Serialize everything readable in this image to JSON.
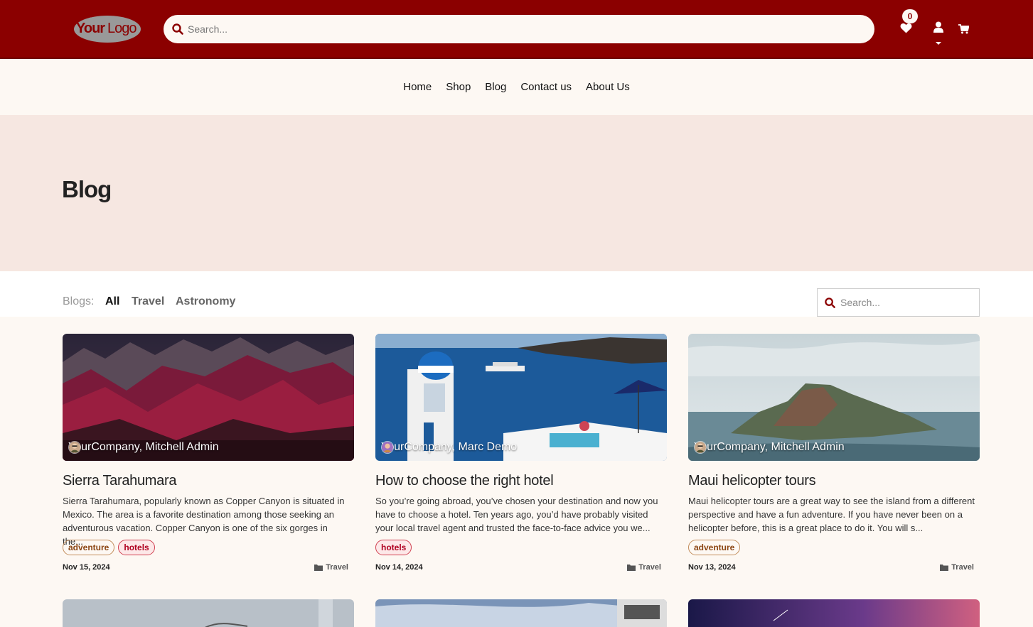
{
  "header": {
    "logo_text": "YourLogo",
    "search_placeholder": "Search...",
    "wishlist_count": "0",
    "brand_color": "#8b0000"
  },
  "nav": {
    "items": [
      {
        "label": "Home"
      },
      {
        "label": "Shop"
      },
      {
        "label": "Blog"
      },
      {
        "label": "Contact us"
      },
      {
        "label": "About Us"
      }
    ]
  },
  "hero": {
    "title": "Blog"
  },
  "filters": {
    "label": "Blogs:",
    "items": [
      {
        "label": "All",
        "active": true
      },
      {
        "label": "Travel",
        "active": false
      },
      {
        "label": "Astronomy",
        "active": false
      }
    ],
    "search_placeholder": "Search..."
  },
  "posts": [
    {
      "author": "YourCompany, Mitchell Admin",
      "title": "Sierra Tarahumara",
      "excerpt": "Sierra Tarahumara, popularly known as Copper Canyon is situated in Mexico. The area is a favorite destination among those seeking an adventurous vacation. Copper Canyon is one of the six gorges in the...",
      "tags": [
        "adventure",
        "hotels"
      ],
      "date": "Nov 15, 2024",
      "category": "Travel"
    },
    {
      "author": "YourCompany, Marc Demo",
      "title": "How to choose the right hotel",
      "excerpt": "So you’re going abroad, you’ve chosen your destination and now you have to choose a hotel. Ten years ago, you’d have probably visited your local travel agent and trusted the face-to-face advice you we...",
      "tags": [
        "hotels"
      ],
      "date": "Nov 14, 2024",
      "category": "Travel"
    },
    {
      "author": "YourCompany, Mitchell Admin",
      "title": "Maui helicopter tours",
      "excerpt": "Maui helicopter tours are a great way to see the island from a different perspective and have a fun adventure. If you have never been on a helicopter before, this is a great place to do it. You will s...",
      "tags": [
        "adventure"
      ],
      "date": "Nov 13, 2024",
      "category": "Travel"
    }
  ]
}
